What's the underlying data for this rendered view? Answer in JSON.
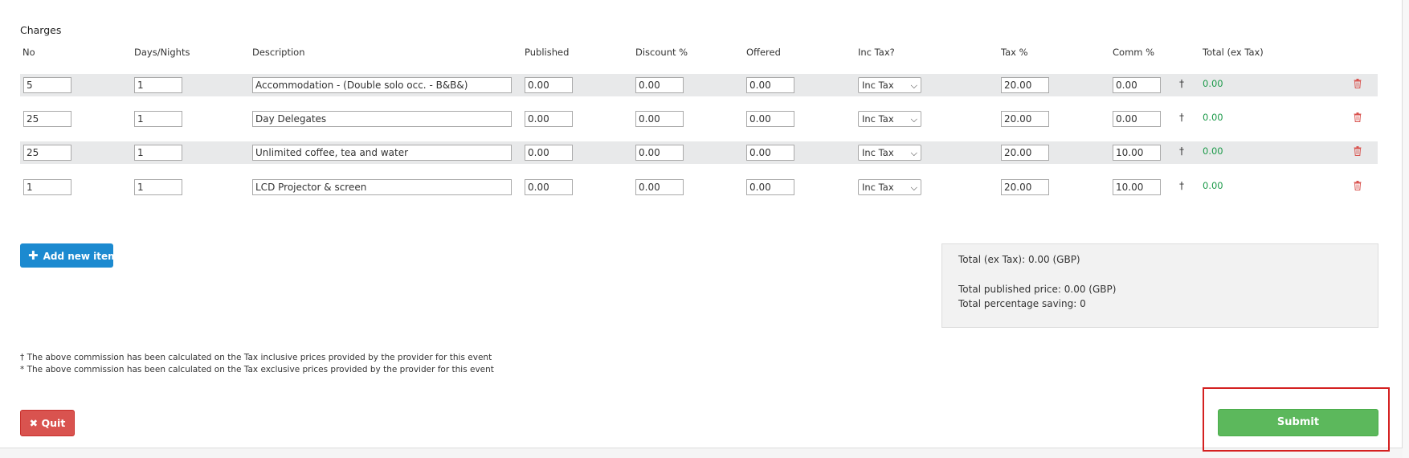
{
  "section_title": "Charges",
  "headers": {
    "no": "No",
    "days": "Days/Nights",
    "description": "Description",
    "published": "Published",
    "discount": "Discount %",
    "offered": "Offered",
    "inc_tax": "Inc Tax?",
    "tax": "Tax %",
    "comm": "Comm %",
    "total": "Total (ex Tax)"
  },
  "rows": [
    {
      "no": "5",
      "days": "1",
      "description": "Accommodation - (Double solo occ. - B&B&)",
      "published": "0.00",
      "discount": "0.00",
      "offered": "0.00",
      "inc_tax": "Inc Tax",
      "tax": "20.00",
      "comm": "0.00",
      "marker": "†",
      "total": "0.00"
    },
    {
      "no": "25",
      "days": "1",
      "description": "Day Delegates",
      "published": "0.00",
      "discount": "0.00",
      "offered": "0.00",
      "inc_tax": "Inc Tax",
      "tax": "20.00",
      "comm": "0.00",
      "marker": "†",
      "total": "0.00"
    },
    {
      "no": "25",
      "days": "1",
      "description": "Unlimited coffee, tea and water",
      "published": "0.00",
      "discount": "0.00",
      "offered": "0.00",
      "inc_tax": "Inc Tax",
      "tax": "20.00",
      "comm": "10.00",
      "marker": "†",
      "total": "0.00"
    },
    {
      "no": "1",
      "days": "1",
      "description": "LCD Projector & screen",
      "published": "0.00",
      "discount": "0.00",
      "offered": "0.00",
      "inc_tax": "Inc Tax",
      "tax": "20.00",
      "comm": "10.00",
      "marker": "†",
      "total": "0.00"
    }
  ],
  "add_item_label": "Add new item",
  "summary": {
    "total_ex_tax": "Total (ex Tax): 0.00 (GBP)",
    "total_published": "Total published price: 0.00 (GBP)",
    "total_saving": "Total percentage saving: 0"
  },
  "footnotes": {
    "dagger": "† The above commission has been calculated on the Tax inclusive prices provided by the provider for this event",
    "asterisk": "* The above commission has been calculated on the Tax exclusive prices provided by the provider for this event"
  },
  "quit_label": "Quit",
  "submit_label": "Submit",
  "colors": {
    "primary": "#1c8ad0",
    "danger": "#d9534f",
    "success": "#5cb85c",
    "total_text": "#1d9a4a",
    "highlight": "#d42020"
  }
}
